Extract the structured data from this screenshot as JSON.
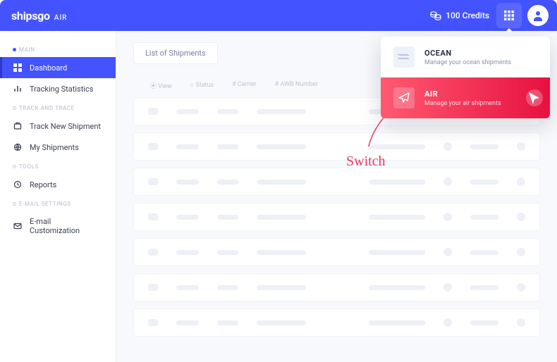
{
  "header": {
    "brand_name": "shipsgo",
    "brand_sub": "AIR",
    "credits_label": "100 Credits"
  },
  "sidebar": {
    "sections": [
      {
        "title": "MAIN",
        "bullet": "filled",
        "items": [
          {
            "label": "Dashboard",
            "active": true
          },
          {
            "label": "Tracking Statistics",
            "active": false
          }
        ]
      },
      {
        "title": "TRACK AND TRACE",
        "bullet": "ring",
        "items": [
          {
            "label": "Track New Shipment"
          },
          {
            "label": "My Shipments"
          }
        ]
      },
      {
        "title": "TOOLS",
        "bullet": "ring",
        "items": [
          {
            "label": "Reports"
          }
        ]
      },
      {
        "title": "E-MAIL SETTINGS",
        "bullet": "ring",
        "items": [
          {
            "label": "E-mail Customization"
          }
        ]
      }
    ]
  },
  "content": {
    "tab_label": "List of Shipments",
    "columns": [
      "⦿ View",
      "○ Status",
      "# Carrier",
      "# AWB Number"
    ],
    "rows_count": 7
  },
  "annotation": {
    "text": "Switch"
  },
  "dropdown": {
    "items": [
      {
        "key": "ocean",
        "title": "OCEAN",
        "subtitle": "Manage your ocean shipments",
        "active": false
      },
      {
        "key": "air",
        "title": "AIR",
        "subtitle": "Manage your air shipments",
        "active": true
      }
    ]
  },
  "colors": {
    "primary": "#4353ff",
    "accent": "#f0365e"
  }
}
